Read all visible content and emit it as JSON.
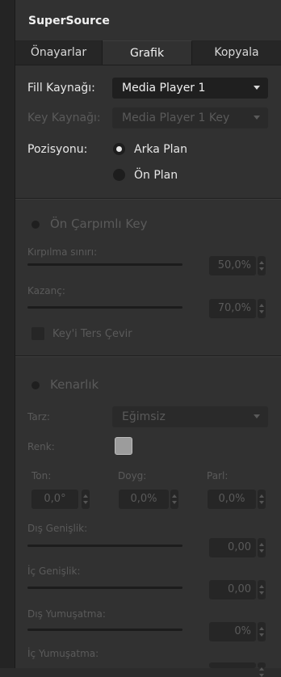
{
  "title": "SuperSource",
  "tabs": [
    "Önayarlar",
    "Grafik",
    "Kopyala"
  ],
  "fill": {
    "label": "Fill Kaynağı:",
    "value": "Media Player 1"
  },
  "key": {
    "label": "Key Kaynağı:",
    "value": "Media Player 1 Key"
  },
  "position": {
    "label": "Pozisyonu:",
    "options": [
      "Arka Plan",
      "Ön Plan"
    ],
    "selected": "Arka Plan"
  },
  "premult": {
    "title": "Ön Çarpımlı Key",
    "clip_label": "Kırpılma sınırı:",
    "clip_value": "50,0%",
    "gain_label": "Kazanç:",
    "gain_value": "70,0%",
    "invert_label": "Key'i Ters Çevir"
  },
  "border": {
    "title": "Kenarlık",
    "style_label": "Tarz:",
    "style_value": "Eğimsiz",
    "color_label": "Renk:",
    "hue_label": "Ton:",
    "hue_value": "0,0°",
    "sat_label": "Doyg:",
    "sat_value": "0,0%",
    "lum_label": "Parl:",
    "lum_value": "0,0%",
    "outer_width_label": "Dış Genişlik:",
    "outer_width_value": "0,00",
    "inner_width_label": "İç Genişlik:",
    "inner_width_value": "0,00",
    "outer_soft_label": "Dış Yumuşatma:",
    "outer_soft_value": "0%",
    "inner_soft_label": "İç Yumuşatma:"
  }
}
